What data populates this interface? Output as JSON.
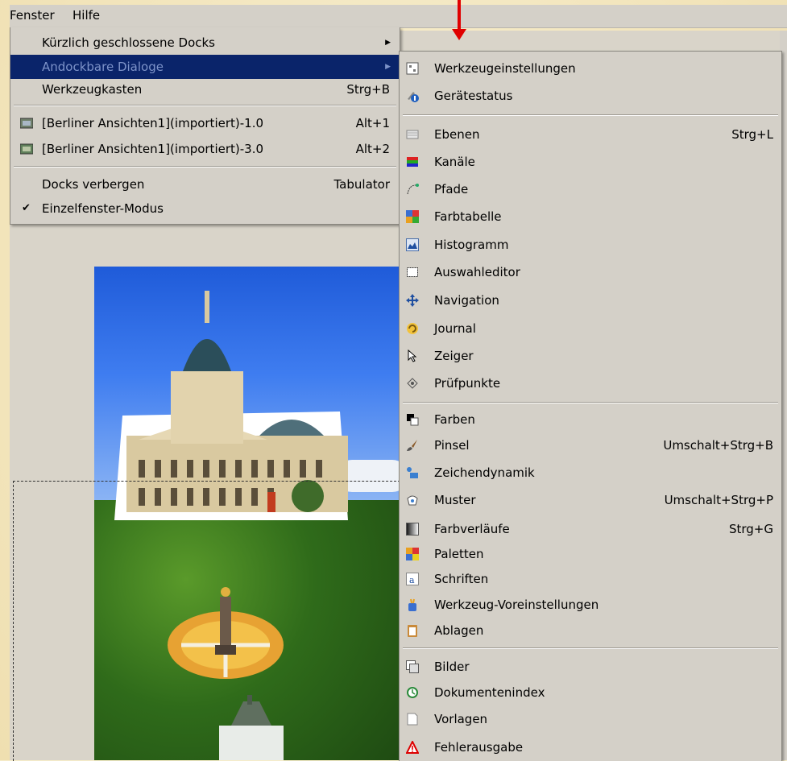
{
  "menubar": {
    "items": [
      {
        "label": "Fenster",
        "mnemonic": "F"
      },
      {
        "label": "Hilfe",
        "mnemonic": "H"
      }
    ]
  },
  "menu_fenster": {
    "items": [
      {
        "label": "Kürzlich geschlossene Docks",
        "accel": "",
        "submenu": true
      },
      {
        "label": "Andockbare Dialoge",
        "accel": "",
        "submenu": true,
        "highlighted": true
      },
      {
        "label": "Werkzeugkasten",
        "accel": "Strg+B"
      },
      {
        "label": "[Berliner Ansichten1](importiert)-1.0",
        "accel": "Alt+1",
        "icon": "image-thumbnail-icon"
      },
      {
        "label": "[Berliner Ansichten1](importiert)-3.0",
        "accel": "Alt+2",
        "icon": "image-thumbnail-icon"
      },
      {
        "label": "Docks verbergen",
        "accel": "Tabulator"
      },
      {
        "label": "Einzelfenster-Modus",
        "accel": "",
        "checked": true
      }
    ]
  },
  "menu_dialoge": {
    "items": [
      {
        "label": "Werkzeugeinstellungen",
        "accel": "",
        "icon": "tool-options-icon"
      },
      {
        "label": "Gerätestatus",
        "accel": "",
        "icon": "device-status-icon"
      },
      {
        "label": "Ebenen",
        "accel": "Strg+L",
        "icon": "layers-icon"
      },
      {
        "label": "Kanäle",
        "accel": "",
        "icon": "channels-icon"
      },
      {
        "label": "Pfade",
        "accel": "",
        "icon": "paths-icon"
      },
      {
        "label": "Farbtabelle",
        "accel": "",
        "icon": "colormap-icon"
      },
      {
        "label": "Histogramm",
        "accel": "",
        "icon": "histogram-icon"
      },
      {
        "label": "Auswahleditor",
        "accel": "",
        "icon": "selection-editor-icon"
      },
      {
        "label": "Navigation",
        "accel": "",
        "icon": "navigation-icon"
      },
      {
        "label": "Journal",
        "accel": "",
        "icon": "undo-history-icon"
      },
      {
        "label": "Zeiger",
        "accel": "",
        "icon": "pointer-icon"
      },
      {
        "label": "Prüfpunkte",
        "accel": "",
        "icon": "sample-points-icon"
      },
      {
        "label": "Farben",
        "accel": "",
        "icon": "colors-icon"
      },
      {
        "label": "Pinsel",
        "accel": "Umschalt+Strg+B",
        "icon": "brush-icon"
      },
      {
        "label": "Zeichendynamik",
        "accel": "",
        "icon": "paint-dynamics-icon"
      },
      {
        "label": "Muster",
        "accel": "Umschalt+Strg+P",
        "icon": "pattern-icon"
      },
      {
        "label": "Farbverläufe",
        "accel": "Strg+G",
        "icon": "gradient-icon"
      },
      {
        "label": "Paletten",
        "accel": "",
        "icon": "palette-icon"
      },
      {
        "label": "Schriften",
        "accel": "",
        "icon": "fonts-icon"
      },
      {
        "label": "Werkzeug-Voreinstellungen",
        "accel": "",
        "icon": "tool-presets-icon"
      },
      {
        "label": "Ablagen",
        "accel": "",
        "icon": "buffers-icon"
      },
      {
        "label": "Bilder",
        "accel": "",
        "icon": "images-icon"
      },
      {
        "label": "Dokumentenindex",
        "accel": "",
        "icon": "document-history-icon"
      },
      {
        "label": "Vorlagen",
        "accel": "",
        "icon": "templates-icon"
      },
      {
        "label": "Fehlerausgabe",
        "accel": "",
        "icon": "error-console-icon"
      }
    ]
  },
  "colors": {
    "menu_bg": "#d4d0c8",
    "highlight_bg": "#0a246a",
    "highlight_text": "#7d93c9",
    "annotation_arrow": "#e00000"
  }
}
